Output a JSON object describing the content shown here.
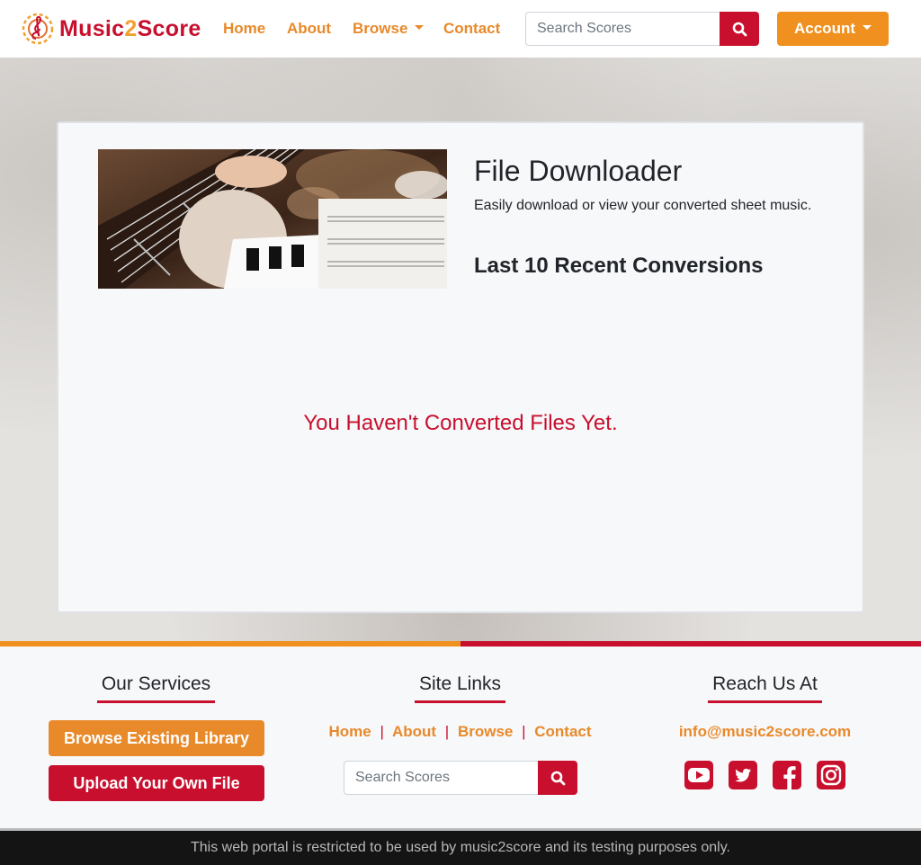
{
  "navbar": {
    "brand": {
      "part1": "Music",
      "part2": "2",
      "part3": "Score"
    },
    "links": {
      "home": "Home",
      "about": "About",
      "browse": "Browse",
      "contact": "Contact"
    },
    "search": {
      "placeholder": "Search Scores",
      "value": ""
    },
    "account_label": "Account"
  },
  "main": {
    "title": "File Downloader",
    "subtitle": "Easily download or view your converted sheet music.",
    "recent_title": "Last 10 Recent Conversions",
    "empty_message": "You Haven't Converted Files Yet."
  },
  "footer": {
    "services": {
      "heading": "Our Services",
      "browse_button": "Browse Existing Library",
      "upload_button": "Upload Your Own File"
    },
    "site_links": {
      "heading": "Site Links",
      "home": "Home",
      "about": "About",
      "browse": "Browse",
      "contact": "Contact",
      "separator": "|",
      "search_placeholder": "Search Scores"
    },
    "reach": {
      "heading": "Reach Us At",
      "email": "info@music2score.com",
      "social_icons": [
        "youtube-icon",
        "twitter-icon",
        "facebook-icon",
        "instagram-icon"
      ]
    },
    "disclaimer": "This web portal is restricted to be used by music2score and its testing purposes only."
  },
  "colors": {
    "primary_red": "#c8102e",
    "accent_orange": "#f0901e",
    "link_orange": "#e8892a",
    "footer_dark": "#141414"
  }
}
